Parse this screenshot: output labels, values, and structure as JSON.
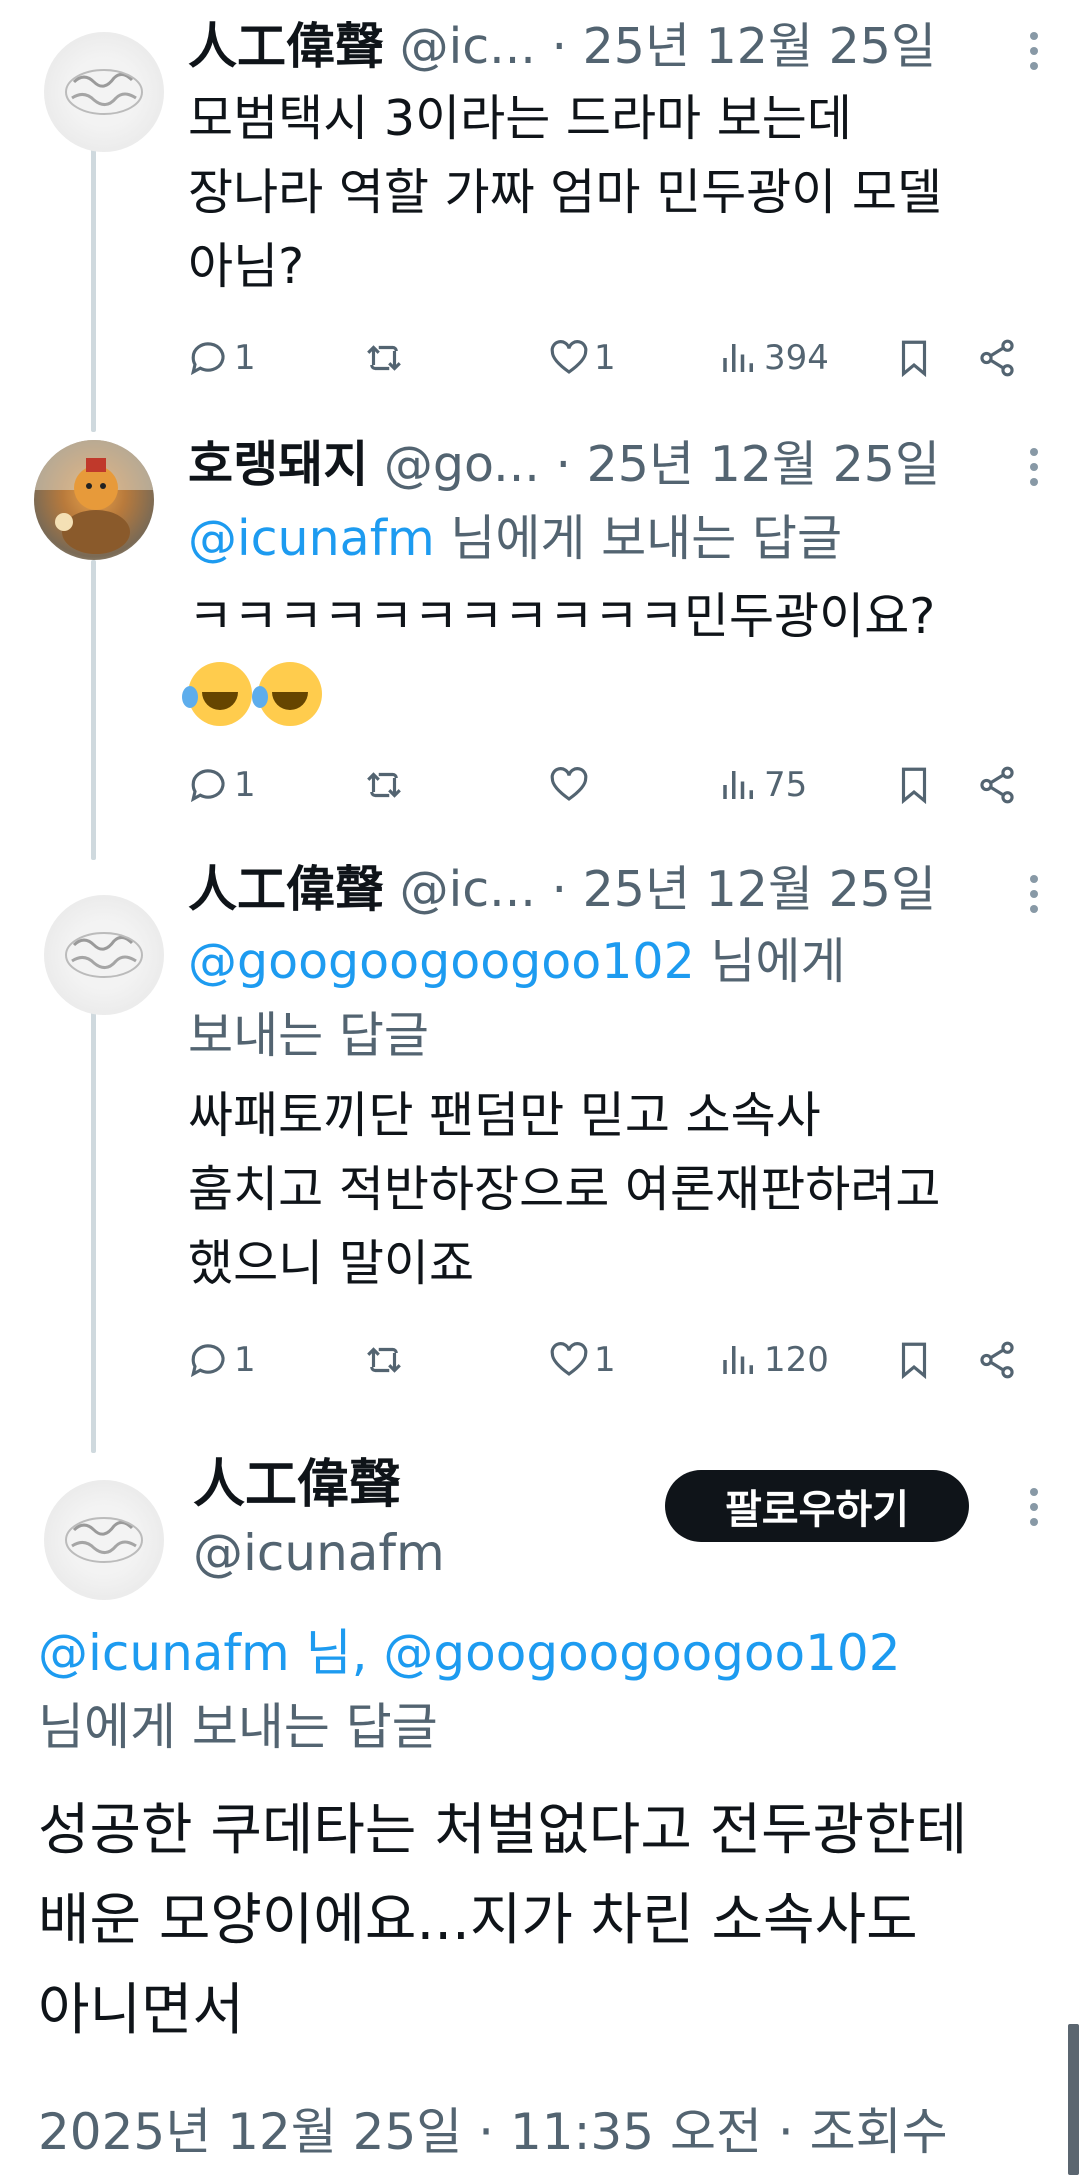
{
  "tweets": [
    {
      "name": "人工偉聲",
      "handle": "@ic...",
      "dot": "·",
      "date": "25년 12월 25일",
      "lines": [
        "모범택시 3이라는 드라마 보는데",
        "장나라 역할 가짜 엄마 민두광이 모델",
        "아님?"
      ],
      "replies": "1",
      "retweets": "",
      "likes": "1",
      "views": "394"
    },
    {
      "name": "호랭돼지",
      "handle": "@go...",
      "dot": "·",
      "date": "25년 12월 25일",
      "reply_mention": "@icunafm",
      "reply_suffix": " 님에게 보내는 답글",
      "lines": [
        "ㅋㅋㅋㅋㅋㅋㅋㅋㅋㅋㅋ민두광이요?"
      ],
      "emoji_names": [
        "rolling-on-floor-laughing-emoji",
        "rolling-on-floor-laughing-emoji"
      ],
      "replies": "1",
      "retweets": "",
      "likes": "",
      "views": "75"
    },
    {
      "name": "人工偉聲",
      "handle": "@ic...",
      "dot": "·",
      "date": "25년 12월 25일",
      "reply_mention": "@googoogoogoo102",
      "reply_suffix": " 님에게",
      "reply_line2": "보내는 답글",
      "lines": [
        "싸패토끼단 팬덤만 믿고  소속사",
        "훔치고 적반하장으로 여론재판하려고",
        "했으니 말이죠"
      ],
      "replies": "1",
      "retweets": "",
      "likes": "1",
      "views": "120"
    }
  ],
  "main": {
    "name": "人工偉聲",
    "handle": "@icunafm",
    "follow_label": "팔로우하기",
    "reply_mention1": "@icunafm",
    "reply_mid": " 님, ",
    "reply_mention2": "@googoogoogoo102",
    "reply_line2": "님에게 보내는 답글",
    "lines": [
      "성공한 쿠데타는 처벌없다고 전두광한테",
      "배운 모양이에요...지가 차린 소속사도",
      "아니면서"
    ],
    "meta": "2025년 12월 25일 · 11:35 오전 · 조회수"
  },
  "colors": {
    "mention": "#1d9bf0",
    "secondary": "#536471",
    "text": "#0f1419",
    "thread_line": "#cfd9de"
  }
}
